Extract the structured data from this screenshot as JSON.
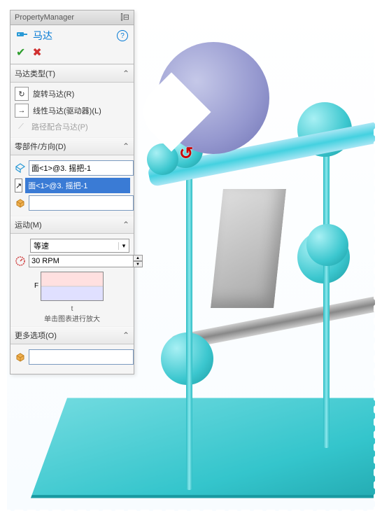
{
  "header": {
    "title": "PropertyManager"
  },
  "feature": {
    "icon": "motor-icon",
    "title": "马达"
  },
  "sections": {
    "motor_type": {
      "title": "马达类型(T)",
      "options": {
        "rotary": "旋转马达(R)",
        "linear": "线性马达(驱动器)(L)",
        "path": "路径配合马达(P)"
      }
    },
    "component": {
      "title": "零部件/方向(D)",
      "face_field": "面<1>@3. 摇把-1",
      "direction_field": "面<1>@3. 摇把-1",
      "relative_field": ""
    },
    "motion": {
      "title": "运动(M)",
      "type_value": "等速",
      "speed_value": "30 RPM",
      "chart_axis_y": "F",
      "chart_axis_x": "t",
      "chart_hint": "单击图表进行放大"
    },
    "more": {
      "title": "更多选项(O)",
      "field": ""
    }
  }
}
